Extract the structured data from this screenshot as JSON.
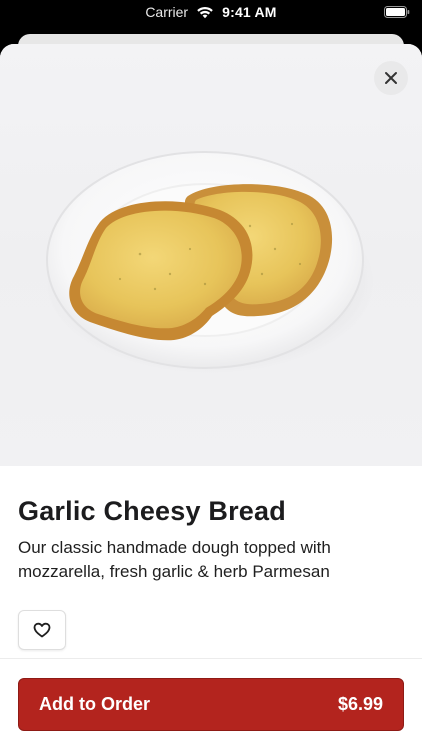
{
  "status_bar": {
    "carrier": "Carrier",
    "time": "9:41 AM",
    "icons": [
      "wifi-icon",
      "battery-icon"
    ]
  },
  "product": {
    "name": "Garlic Cheesy Bread",
    "description": "Our classic handmade dough topped with mozzarella, fresh garlic & herb Parmesan",
    "image": "garlic-cheesy-bread-photo",
    "price": "$6.99"
  },
  "actions": {
    "close_icon": "close-icon",
    "favorite_icon": "heart-icon",
    "add_label": "Add to Order"
  },
  "colors": {
    "accent": "#b3241e",
    "background": "#ffffff",
    "text": "#1c1c1e"
  }
}
